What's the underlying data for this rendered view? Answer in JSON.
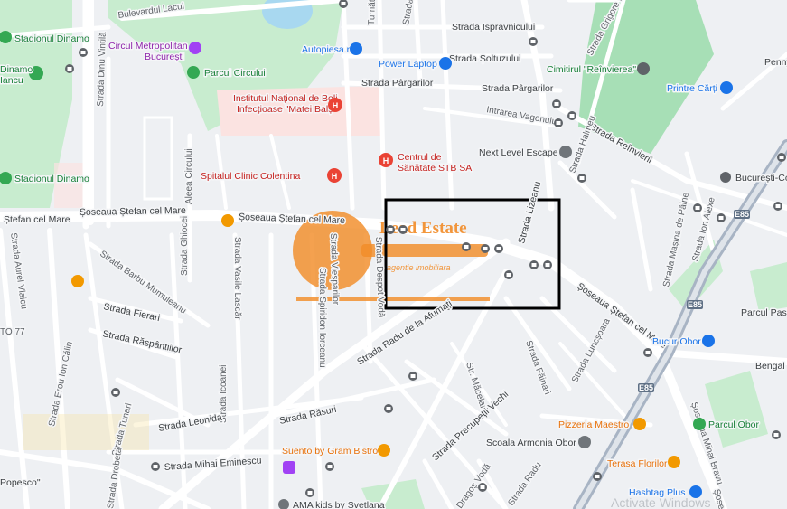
{
  "map": {
    "colors": {
      "background": "#eef0f3",
      "park": "#c8eccf",
      "park_dark": "#8fd9a2",
      "hospital_area": "#fbe3e1",
      "water": "#a8d8f0",
      "road": "#ffffff",
      "highway": "#a8b4c4",
      "highlight_box": "#000000",
      "logo_orange": "#f28c28"
    },
    "labels": {
      "bulevardul_lacul": "Bulevardul Lacul",
      "stadionul_dinamo_top": "Stadionul Dinamo",
      "dinamo_iancu": "Dinamo",
      "iancu": "Iancu",
      "stadionul_dinamo": "Stadionul Dinamo",
      "stefan_cel_mare_left": "Ștefan cel Mare",
      "circul_line1": "Circul Metropolitan",
      "circul_line2": "București",
      "parcul_circului": "Parcul Circului",
      "institut_line1": "Institutul Național de Boli",
      "institut_line2": "Infecțioase \"Matei Balș\"",
      "spitalul_colentina": "Spitalul Clinic Colentina",
      "centrul_line1": "Centrul de",
      "centrul_line2": "Sănătate STB SA",
      "autopiesa": "Autopiesa.ro",
      "power_laptop": "Power Laptop",
      "cimitirul": "Cimitirul \"Reînvierea\"",
      "printre_carti": "Printre Cărți",
      "penny": "Penny",
      "next_level_escape": "Next Level Escape",
      "bucuresti_co": "București-Co",
      "strada_ispravnicului": "Strada Ispravnicului",
      "strada_soltuzului": "Strada Șoltuzului",
      "strada_pargarilor_a": "Strada Pârgarilor",
      "strada_pargarilor_b": "Strada Pârgarilor",
      "intrarea_vagonului": "Intrarea Vagonului",
      "strada_reinvierii": "Strada Reînvierii",
      "strada_grigore": "Strada Grigore Io",
      "strada_halmeu": "Strada Halmeu",
      "strada_dinu_vintila": "Strada Dinu Vintilă",
      "aleea_circului": "Aleea Circului",
      "turnatorilor": "Turnătorilor",
      "strada_ana": "Strada Ana",
      "sos_stefan_left": "Șoseaua Ștefan cel Mare",
      "sos_stefan_mid": "Șoseaua Ștefan cel Mare",
      "sos_stefan_right": "Șoseaua Ștefan cel Mare",
      "strada_lizeanu": "Strada Lizeanu",
      "strada_masina": "Strada Mașina de Pâine",
      "strada_ion_alexe": "Strada Ion Alexe",
      "strada_aurel_vlaicu": "Strada Aurel Vlaicu",
      "strada_barbu": "Strada Barbu Mumuleanu",
      "strada_ghiocei": "Strada Ghiocei",
      "strada_vasile_lascar": "Strada Vasile Lascăr",
      "strada_vlesparilor": "Strada Viesparilor",
      "strada_spiridon": "Strada Spiridon Iorceanu",
      "strada_despot_voda": "Strada Despot Vodă",
      "strada_fierari": "Strada Fierari",
      "strada_raspantiilor": "Strada Răspântiilor",
      "to77": "TO 77",
      "strada_radu_afumati": "Strada Radu de la Afumați",
      "strada_luncsoara": "Strada Luncșoara",
      "strada_fainari": "Strada Făinari",
      "str_macelari": "Str. Măcelari",
      "parcul_pasa": "Parcul Pasă",
      "bucur_obor": "Bucur Obor",
      "bengal": "Bengal I",
      "strada_erou_calin": "Strada Erou Ion Călin",
      "strada_icoanei": "Strada Icoanei",
      "strada_tunari": "Strada Tunari",
      "strada_leonida": "Strada Leonida",
      "strada_rasuri": "Strada Răsuri",
      "strada_precupetii": "Strada Precupeții Vechi",
      "pizzeria_maestro": "Pizzeria Maestro",
      "parcul_obor": "Parcul Obor",
      "scoala_armonia": "Scoala Armonia Obor",
      "suento": "Suento by Gram Bistro",
      "strada_drobeta": "Strada Drobeta",
      "strada_mihai_eminescu": "Strada Mihai Eminescu",
      "terasa_florilor": "Terasa Florilor",
      "hashtag_plus": "Hashtag Plus",
      "dragos_voda": "Dragoș Vodă",
      "strada_radu": "Strada Radu",
      "popesco": "Popesco\"",
      "ama_kids": "AMA kids by Svetlana",
      "sos_mihai_bravu": "Șoseaua Mihai Bravu",
      "sos_right_edge": "Șosea",
      "e85_a": "E85",
      "e85_b": "E85",
      "e85_c": "E85",
      "activate_windows": "Activate Windows"
    },
    "watermark": {
      "brand_line1": "Lead Estate",
      "brand_line2": "agentie imobiliara"
    },
    "icons": [
      "stadium-icon",
      "circus-icon",
      "hospital-icon",
      "shopping-icon",
      "cemetery-icon",
      "bus-stop-icon",
      "restaurant-icon",
      "metro-icon",
      "escape-room-icon",
      "school-icon"
    ]
  }
}
